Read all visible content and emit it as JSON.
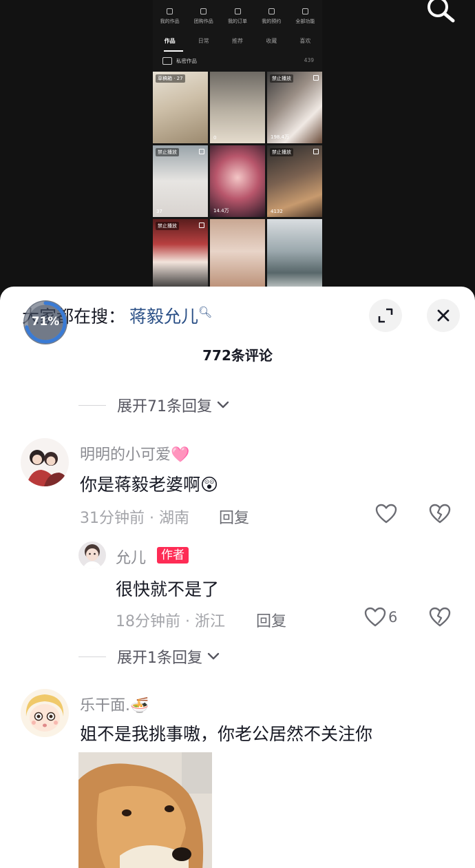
{
  "video": {
    "shortcuts": [
      "我的作品",
      "团购作品",
      "我的订单",
      "我的预约",
      "全部功能"
    ],
    "tabs": [
      "作品",
      "日常",
      "推荐",
      "收藏",
      "喜欢"
    ],
    "active_tab_index": 0,
    "private_label": "私密作品",
    "private_count": "439",
    "thumbs": [
      {
        "tag": "草稿箱 · 27",
        "plays": ""
      },
      {
        "tag": "",
        "plays": "0"
      },
      {
        "tag": "禁止播放",
        "plays": "198.4万"
      },
      {
        "tag": "禁止播放",
        "plays": "37"
      },
      {
        "tag": "",
        "plays": "14.4万"
      },
      {
        "tag": "禁止播放",
        "plays": "4132"
      },
      {
        "tag": "禁止播放",
        "plays": ""
      },
      {
        "tag": "",
        "plays": ""
      },
      {
        "tag": "",
        "plays": ""
      }
    ]
  },
  "sheet": {
    "hot_search_prefix": "大家都在搜：",
    "hot_search_term": "蒋毅允儿",
    "progress_percent": 71,
    "progress_label": "71%",
    "comment_count_label": "772条评论"
  },
  "comments": [
    {
      "expand_label": "展开71条回复"
    },
    {
      "user": "明明的小可爱🩷",
      "text": "你是蒋毅老婆啊😲",
      "time_location": "31分钟前 · 湖南",
      "reply_label": "回复"
    },
    {
      "user": "允儿",
      "badge": "作者",
      "text": "很快就不是了",
      "time_location": "18分钟前 · 浙江",
      "reply_label": "回复",
      "likes": "6"
    },
    {
      "expand_label": "展开1条回复"
    },
    {
      "user": "乐干面.🍜",
      "text": "姐不是我挑事嗷，你老公居然不关注你"
    }
  ],
  "colors": {
    "accent_red": "#fe2c55",
    "link_blue": "#2a4f86",
    "progress_blue": "#3a7bd5"
  },
  "icons": [
    "search-icon",
    "expand-icon",
    "close-icon",
    "heart-icon",
    "broken-heart-icon",
    "chevron-down-icon"
  ]
}
